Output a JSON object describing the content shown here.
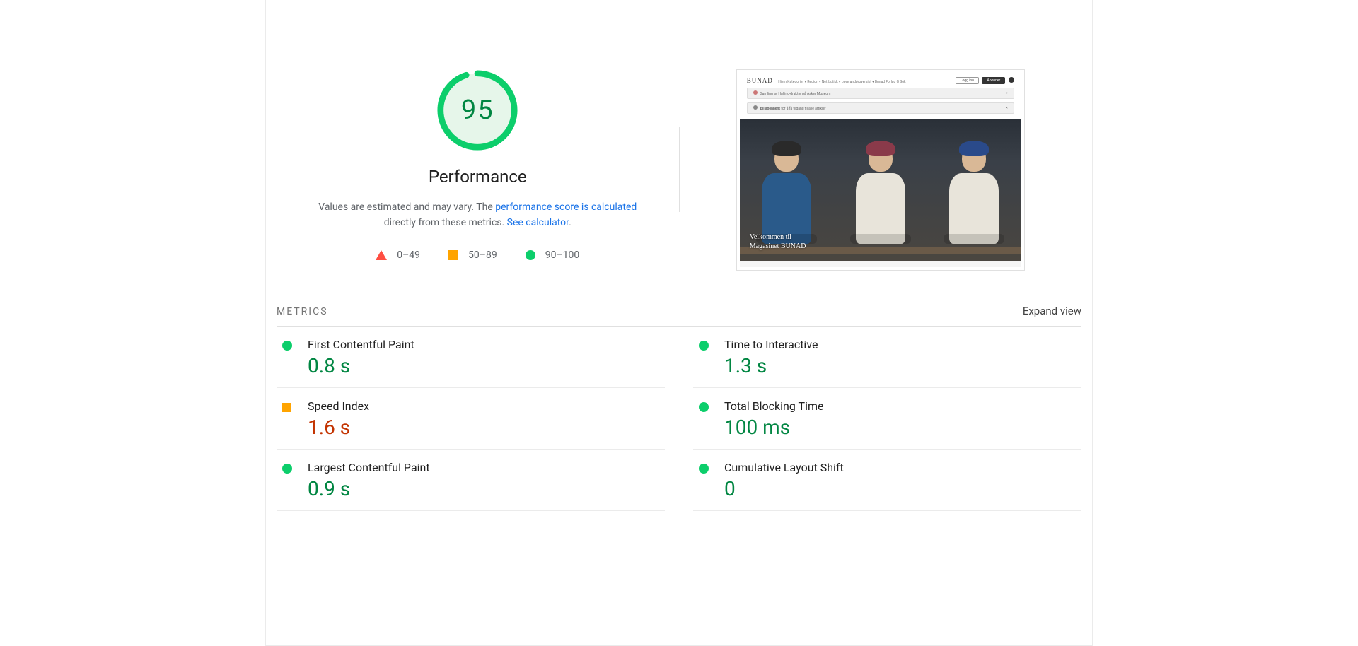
{
  "gauge": {
    "score": "95",
    "percent": 95
  },
  "title": "Performance",
  "description": {
    "lead": "Values are estimated and may vary. The ",
    "link1": "performance score is calculated",
    "mid": " directly from these metrics. ",
    "link2": "See calculator",
    "tail": "."
  },
  "legend": {
    "fail": "0–49",
    "avg": "50–89",
    "pass": "90–100"
  },
  "screenshot": {
    "brand": "BUNAD",
    "nav": "Hjem   Kategorier ▾   Region ▾   Nettbutikk ▾   Leverandøroversikt ▾   Bunad Forlag   Q Søk",
    "login": "Logg inn",
    "subscribe": "Abonner",
    "bar1": "Samling av Halling-drakter på Asker Museum",
    "bar2_strong": "Bli abonnent",
    "bar2_rest": " for å få tilgang til alle artikler",
    "hero1": "Velkommen til",
    "hero2": "Magasinet BUNAD"
  },
  "metrics_header": "METRICS",
  "expand": "Expand view",
  "metrics": [
    {
      "name": "First Contentful Paint",
      "value": "0.8 s",
      "status": "pass"
    },
    {
      "name": "Time to Interactive",
      "value": "1.3 s",
      "status": "pass"
    },
    {
      "name": "Speed Index",
      "value": "1.6 s",
      "status": "avg"
    },
    {
      "name": "Total Blocking Time",
      "value": "100 ms",
      "status": "pass"
    },
    {
      "name": "Largest Contentful Paint",
      "value": "0.9 s",
      "status": "pass"
    },
    {
      "name": "Cumulative Layout Shift",
      "value": "0",
      "status": "pass"
    }
  ]
}
